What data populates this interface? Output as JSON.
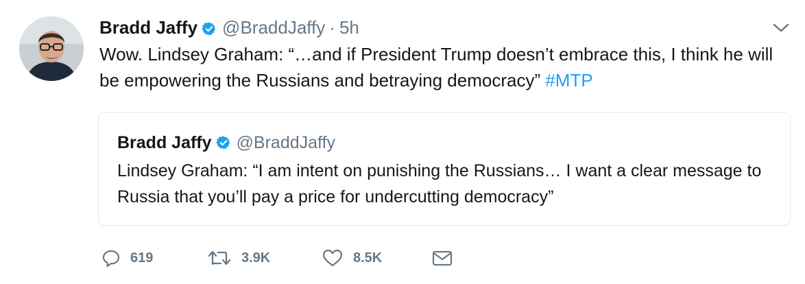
{
  "tweet": {
    "author": {
      "display_name": "Bradd Jaffy",
      "handle": "@BraddJaffy",
      "verified": true
    },
    "separator": "·",
    "timestamp": "5h",
    "text_before_hashtag": "Wow. Lindsey Graham: “…and if President Trump doesn’t embrace this, I think he will be empowering the Russians and betraying democracy” ",
    "hashtag": "#MTP",
    "quoted_tweet": {
      "display_name": "Bradd Jaffy",
      "handle": "@BraddJaffy",
      "verified": true,
      "text": "Lindsey Graham: “I am intent on punishing the Russians… I want a clear message to Russia that you’ll pay a price for undercutting democracy”"
    },
    "actions": {
      "replies": "619",
      "retweets": "3.9K",
      "likes": "8.5K"
    }
  },
  "icons": {
    "verified": "verified-badge-icon",
    "caret": "chevron-down-icon",
    "reply": "reply-icon",
    "retweet": "retweet-icon",
    "like": "heart-icon",
    "message": "envelope-icon"
  },
  "colors": {
    "text": "#14171a",
    "secondary": "#657786",
    "link": "#1da1f2",
    "border": "#e1e8ed",
    "verified": "#1da1f2"
  }
}
